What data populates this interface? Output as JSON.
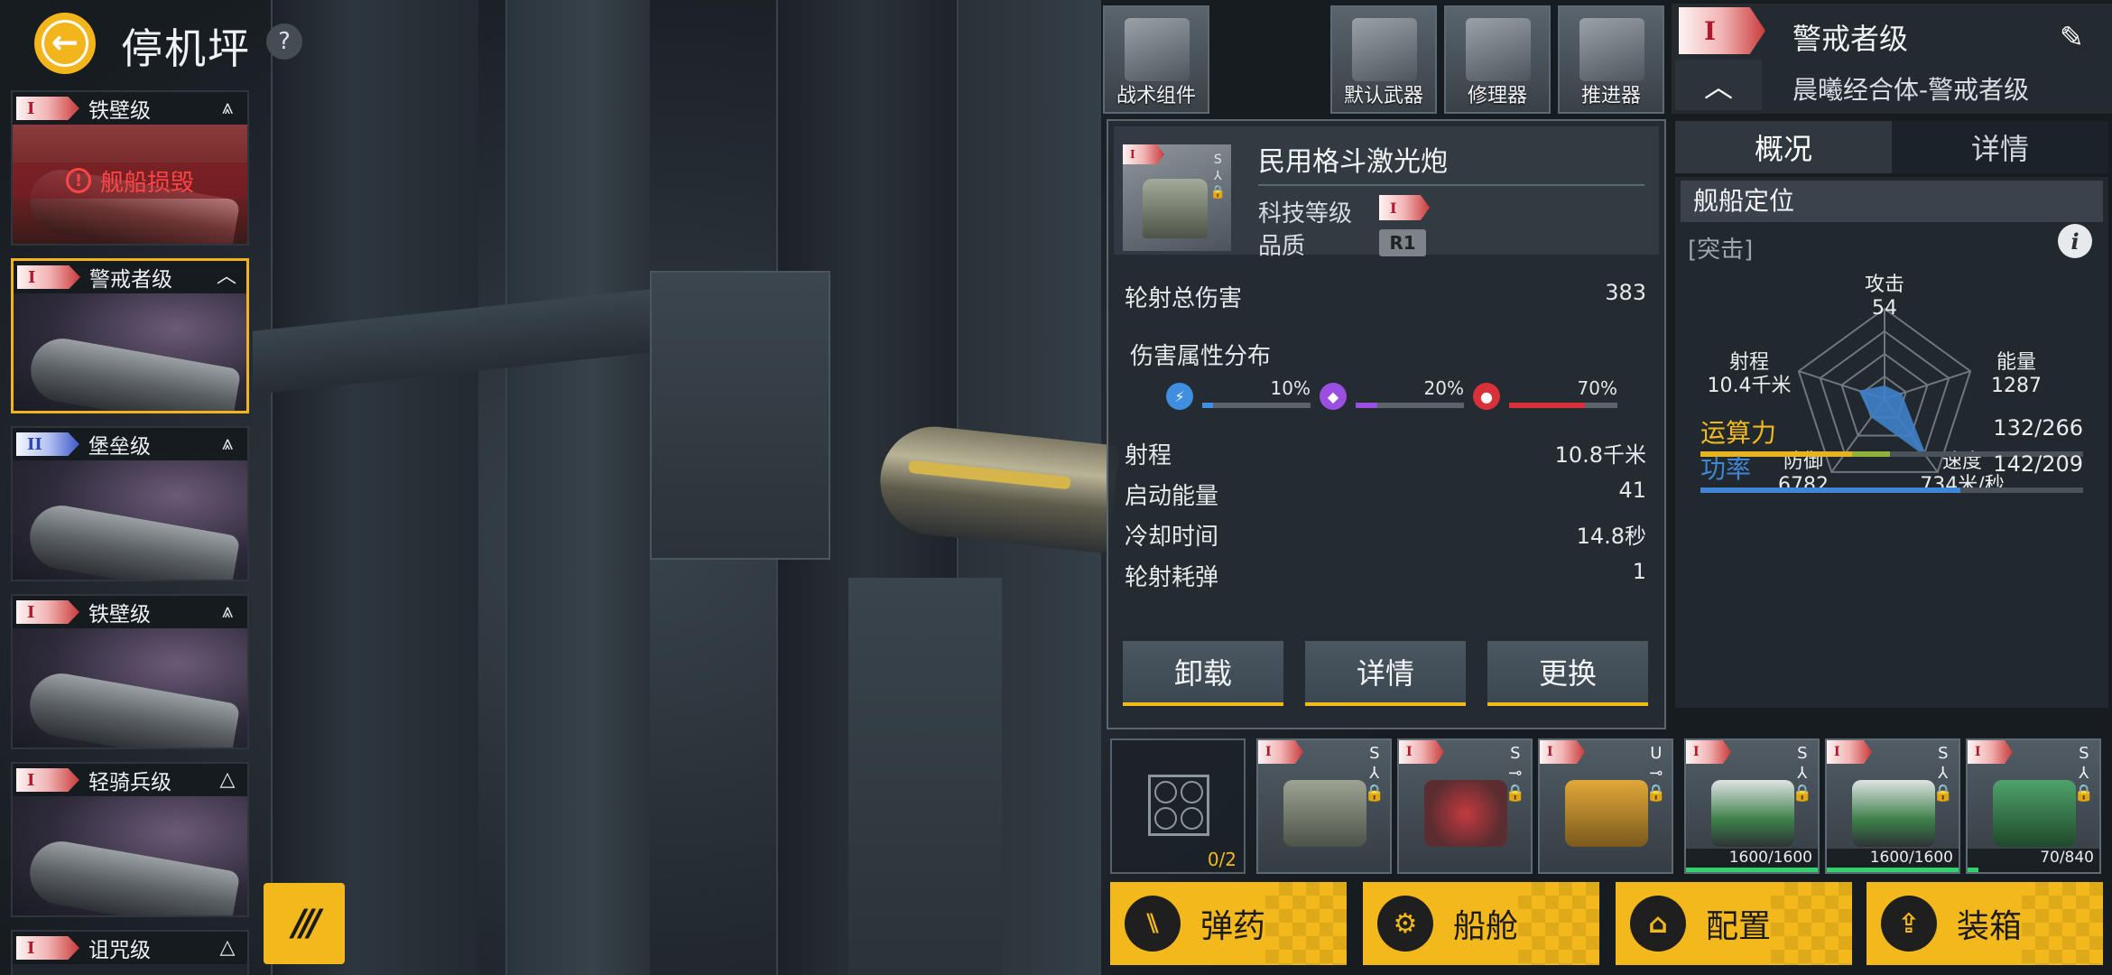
{
  "header": {
    "title": "停机坪",
    "help": "?",
    "back": "←"
  },
  "ships": [
    {
      "tier": "I",
      "name": "铁壁级",
      "toggle": "⩓",
      "status": "舰船损毁",
      "damaged": true
    },
    {
      "tier": "I",
      "name": "警戒者级",
      "toggle": "︿",
      "selected": true
    },
    {
      "tier": "II",
      "name": "堡垒级",
      "toggle": "⩓"
    },
    {
      "tier": "I",
      "name": "铁壁级",
      "toggle": "⩓"
    },
    {
      "tier": "I",
      "name": "轻骑兵级",
      "toggle": "△"
    },
    {
      "tier": "I",
      "name": "诅咒级",
      "toggle": "△"
    }
  ],
  "fleet_button": "///",
  "top_slots": [
    {
      "label": "战术组件"
    },
    {
      "label": "默认武器"
    },
    {
      "label": "修理器"
    },
    {
      "label": "推进器"
    }
  ],
  "ship_info": {
    "tier": "I",
    "class_name": "警戒者级",
    "full_name": "晨曦经合体-警戒者级",
    "collapse": "︿",
    "edit": "✎"
  },
  "tabs": [
    "概况",
    "详情"
  ],
  "overview": {
    "section_title": "舰船定位",
    "role": "[突击]",
    "info": "i",
    "radar": {
      "attack": {
        "label": "攻击",
        "value": "54"
      },
      "energy": {
        "label": "能量",
        "value": "1287"
      },
      "speed": {
        "label": "速度",
        "value": "734米/秒"
      },
      "defense": {
        "label": "防御",
        "value": "6782"
      },
      "range": {
        "label": "射程",
        "value": "10.4千米"
      },
      "levels": {
        "attack": 0.15,
        "energy": 0.2,
        "speed": 0.8,
        "defense": 0.25,
        "range": 0.3
      }
    },
    "compute": {
      "label": "运算力",
      "value": "132/266",
      "fraction": 0.496
    },
    "power": {
      "label": "功率",
      "value": "142/209",
      "fraction": 0.679
    }
  },
  "weapon": {
    "tier": "I",
    "tags": "S\n⅄\n🔒",
    "name": "民用格斗激光炮",
    "tech_label": "科技等级",
    "tech_tier": "I",
    "quality_label": "品质",
    "quality": "R1",
    "total_damage_label": "轮射总伤害",
    "total_damage": "383",
    "dist_label": "伤害属性分布",
    "dist": [
      {
        "icon": "⚡",
        "pct": "10%",
        "fraction": 0.1,
        "color": "#3f8ee0"
      },
      {
        "icon": "◆",
        "pct": "20%",
        "fraction": 0.2,
        "color": "#9b4fe0"
      },
      {
        "icon": "●",
        "pct": "70%",
        "fraction": 0.7,
        "color": "#d8313a"
      }
    ],
    "stats": [
      {
        "label": "射程",
        "value": "10.8千米"
      },
      {
        "label": "启动能量",
        "value": "41"
      },
      {
        "label": "冷却时间",
        "value": "14.8秒"
      },
      {
        "label": "轮射耗弹",
        "value": "1"
      }
    ],
    "buttons": {
      "unload": "卸载",
      "details": "详情",
      "replace": "更换"
    }
  },
  "equipment": {
    "empty_slot_count": "0/2",
    "items": [
      {
        "tier": "I",
        "tag": "S\n⅄\n🔒",
        "hp": "",
        "hp_fraction": 0
      },
      {
        "tier": "I",
        "tag": "S\n⊸\n🔒",
        "hp": "",
        "hp_fraction": 0
      },
      {
        "tier": "I",
        "tag": "U\n⊸\n🔒",
        "hp": "",
        "hp_fraction": 0
      },
      {
        "tier": "I",
        "tag": "S\n⅄\n🔒",
        "hp": "1600/1600",
        "hp_fraction": 1.0
      },
      {
        "tier": "I",
        "tag": "S\n⅄\n🔒",
        "hp": "1600/1600",
        "hp_fraction": 1.0
      },
      {
        "tier": "I",
        "tag": "S\n⅄\n🔒",
        "hp": "70/840",
        "hp_fraction": 0.083
      }
    ]
  },
  "actions": [
    {
      "label": "弹药",
      "icon": "⑊"
    },
    {
      "label": "船舱",
      "icon": "⚙"
    },
    {
      "label": "配置",
      "icon": "⌂"
    },
    {
      "label": "装箱",
      "icon": "⇪"
    }
  ],
  "colors": {
    "accent": "#f2b81c",
    "compute_bar": "#e8b321",
    "power_bar": "#3f86d6",
    "radar_fill": "#3f7fc9"
  }
}
